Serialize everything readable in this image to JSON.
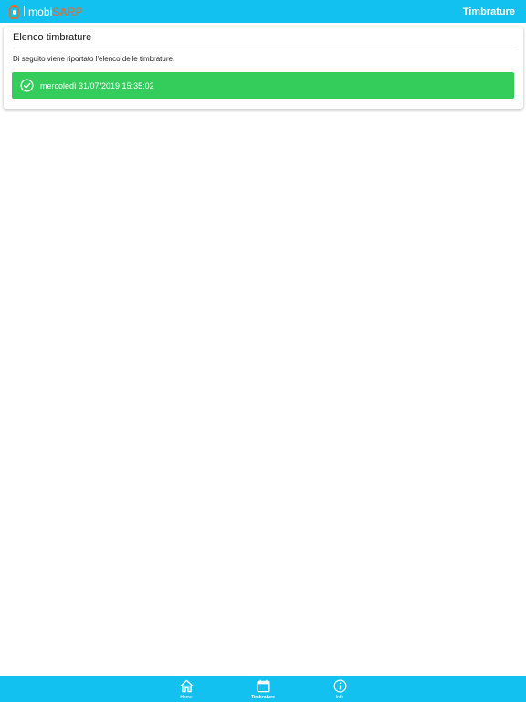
{
  "header": {
    "brand_part1": "mobi",
    "brand_part2": "SARP",
    "title": "Timbrature"
  },
  "card": {
    "title": "Elenco timbrature",
    "description": "Di seguito viene riportato l'elenco delle timbrature.",
    "entries": [
      {
        "label": "mercoledì 31/07/2019 15:35:02",
        "icon": "check-circle-icon"
      }
    ]
  },
  "tabbar": {
    "tabs": [
      {
        "label": "Home",
        "icon": "home-icon",
        "active": false
      },
      {
        "label": "Timbrature",
        "icon": "calendar-icon",
        "active": true
      },
      {
        "label": "Info",
        "icon": "info-icon",
        "active": false
      }
    ]
  },
  "colors": {
    "primary": "#12c1f0",
    "brand_accent": "#f26522",
    "success": "#34cd5c"
  }
}
